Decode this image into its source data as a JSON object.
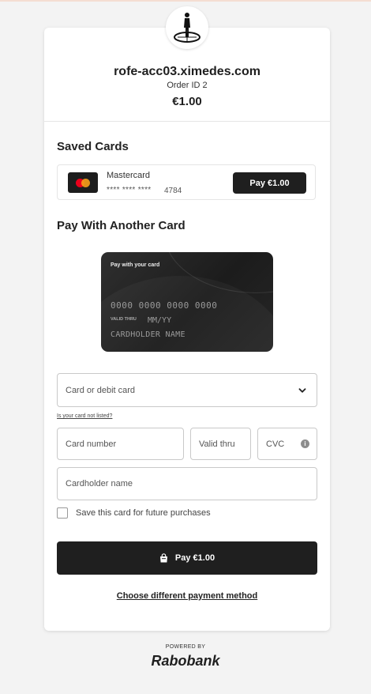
{
  "merchant": {
    "domain": "rofe-acc03.ximedes.com",
    "order": "Order ID 2",
    "amount": "€1.00"
  },
  "saved_cards": {
    "heading": "Saved Cards",
    "card": {
      "brand": "Mastercard",
      "mask": "**** **** ****",
      "last4": "4784",
      "pay_label": "Pay €1.00"
    }
  },
  "another_card": {
    "heading": "Pay With Another Card",
    "visual": {
      "label": "Pay with your card",
      "number": "0000 0000 0000 0000",
      "valid_thru": "VALID THRU",
      "expiry": "MM/YY",
      "holder": "CARDHOLDER NAME"
    }
  },
  "form": {
    "card_type_select": "Card or debit card",
    "not_listed_link": "Is your card not listed?",
    "card_number_placeholder": "Card number",
    "valid_thru_placeholder": "Valid thru",
    "cvc_placeholder": "CVC",
    "cardholder_placeholder": "Cardholder name",
    "save_card_label": "Save this card for future purchases",
    "save_card_checked": false,
    "pay_label": "Pay €1.00",
    "choose_method_link": "Choose different payment method"
  },
  "footer": {
    "powered_by": "POWERED BY",
    "brand": "Rabobank"
  },
  "icons": {
    "logo": "merchant-logo-icon",
    "card_brand": "mastercard-icon",
    "dropdown": "chevron-down-icon",
    "info": "info-icon",
    "pay": "shopping-bag-icon"
  },
  "colors": {
    "primary_button": "#1f1f1f",
    "background": "#f3f3f3",
    "panel": "#ffffff",
    "mastercard_red": "#eb001b",
    "mastercard_orange": "#f79e1b"
  }
}
